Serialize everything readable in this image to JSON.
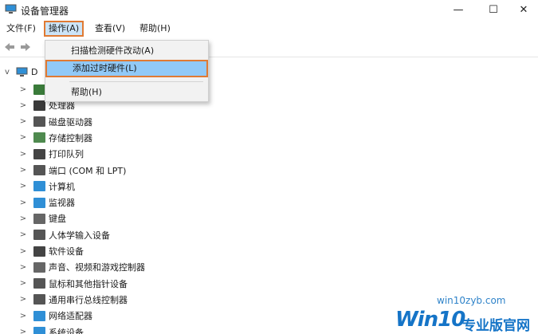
{
  "window": {
    "title": "设备管理器",
    "minimize": "—",
    "maximize": "☐",
    "close": "✕"
  },
  "menubar": {
    "file": "文件(F)",
    "action": "操作(A)",
    "view": "查看(V)",
    "help": "帮助(H)"
  },
  "dropdown": {
    "scan": "扫描检测硬件改动(A)",
    "add_legacy": "添加过时硬件(L)",
    "help": "帮助(H)"
  },
  "tree": {
    "root_label": "D",
    "items": [
      {
        "label": "",
        "icon": "network-card-icon",
        "color": "#3a7b3a"
      },
      {
        "label": "处理器",
        "icon": "processor-icon",
        "color": "#3a3a3a"
      },
      {
        "label": "磁盘驱动器",
        "icon": "disk-drive-icon",
        "color": "#555555"
      },
      {
        "label": "存储控制器",
        "icon": "storage-controller-icon",
        "color": "#4f8a4f"
      },
      {
        "label": "打印队列",
        "icon": "printer-icon",
        "color": "#444444"
      },
      {
        "label": "端口 (COM 和 LPT)",
        "icon": "port-icon",
        "color": "#555555"
      },
      {
        "label": "计算机",
        "icon": "computer-icon",
        "color": "#2f8fd6"
      },
      {
        "label": "监视器",
        "icon": "monitor-icon",
        "color": "#2f8fd6"
      },
      {
        "label": "键盘",
        "icon": "keyboard-icon",
        "color": "#666666"
      },
      {
        "label": "人体学输入设备",
        "icon": "hid-icon",
        "color": "#555555"
      },
      {
        "label": "软件设备",
        "icon": "software-device-icon",
        "color": "#444444"
      },
      {
        "label": "声音、视频和游戏控制器",
        "icon": "sound-icon",
        "color": "#666666"
      },
      {
        "label": "鼠标和其他指针设备",
        "icon": "mouse-icon",
        "color": "#555555"
      },
      {
        "label": "通用串行总线控制器",
        "icon": "usb-icon",
        "color": "#555555"
      },
      {
        "label": "网络适配器",
        "icon": "network-adapter-icon",
        "color": "#2f8fd6"
      },
      {
        "label": "系统设备",
        "icon": "system-device-icon",
        "color": "#2f8fd6"
      }
    ]
  },
  "watermark": {
    "url": "win10zyb.com",
    "brand": "Win10",
    "sub": "专业版官网"
  }
}
